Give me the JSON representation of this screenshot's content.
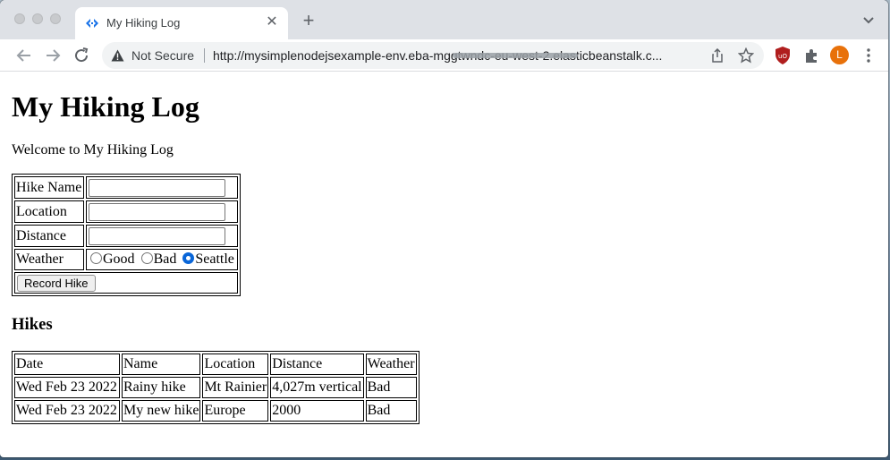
{
  "browser": {
    "tab_title": "My Hiking Log",
    "security_label": "Not Secure",
    "url": "http://mysimplenodejsexample-env.eba-mggtwndc-eu-west-2.elasticbeanstalk.c...",
    "avatar_initial": "L",
    "colors": {
      "tabstrip": "#dee1e6",
      "avatar": "#e8710a",
      "ublock": "#b01e1e"
    }
  },
  "page": {
    "title": "My Hiking Log",
    "welcome": "Welcome to My Hiking Log",
    "form": {
      "hike_name_label": "Hike Name",
      "location_label": "Location",
      "distance_label": "Distance",
      "weather_label": "Weather",
      "hike_name_value": "",
      "location_value": "",
      "distance_value": "",
      "weather_options": [
        "Good",
        "Bad",
        "Seattle"
      ],
      "weather_selected": "Seattle",
      "submit_label": "Record Hike"
    },
    "hikes_heading": "Hikes",
    "hikes_table": {
      "headers": [
        "Date",
        "Name",
        "Location",
        "Distance",
        "Weather"
      ],
      "rows": [
        [
          "Wed Feb 23 2022",
          "Rainy hike",
          "Mt Rainier",
          "4,027m vertical",
          "Bad"
        ],
        [
          "Wed Feb 23 2022",
          "My new hike",
          "Europe",
          "2000",
          "Bad"
        ]
      ]
    }
  }
}
